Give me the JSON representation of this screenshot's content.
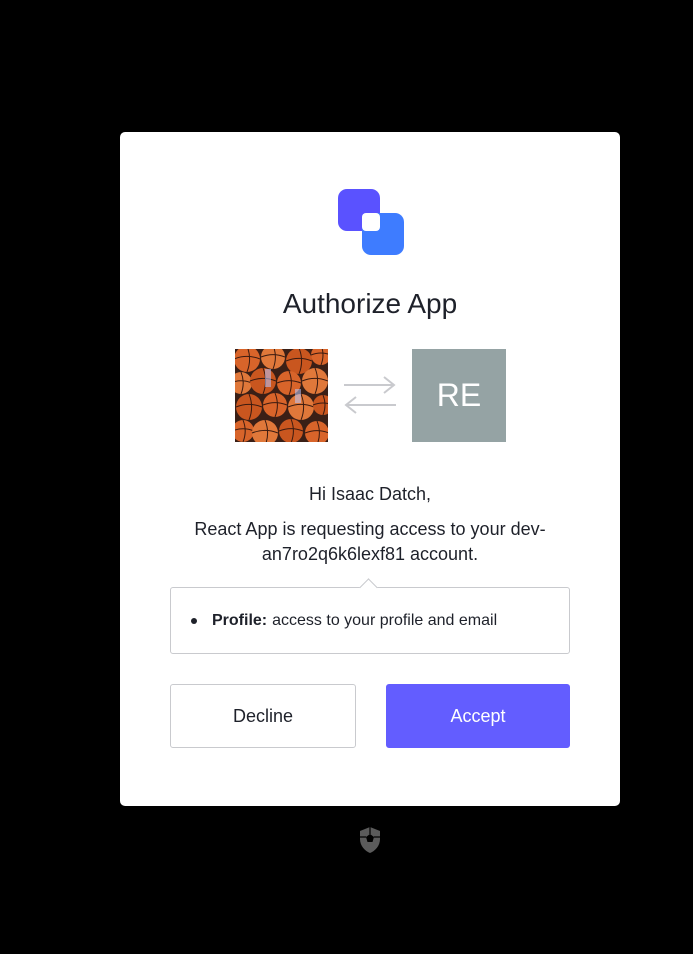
{
  "dialog": {
    "title": "Authorize App",
    "user_avatar_icon": "basketball-photo",
    "swap_icon": "swap-arrows-icon",
    "app_avatar_initials": "RE",
    "greeting": "Hi Isaac Datch,",
    "request_line_1": "React App is requesting access to your dev-",
    "request_line_2": "an7ro2q6k6lexf81 account.",
    "scopes": [
      {
        "name": "Profile:",
        "description": "access to your profile and email"
      }
    ],
    "decline_label": "Decline",
    "accept_label": "Accept"
  },
  "colors": {
    "background": "#000000",
    "card": "#ffffff",
    "accent": "#635dff",
    "logo_dark": "#5a52ff",
    "logo_light": "#3e7cff",
    "app_avatar": "#95a3a4"
  },
  "footer": {
    "icon": "auth0-shield-icon"
  }
}
